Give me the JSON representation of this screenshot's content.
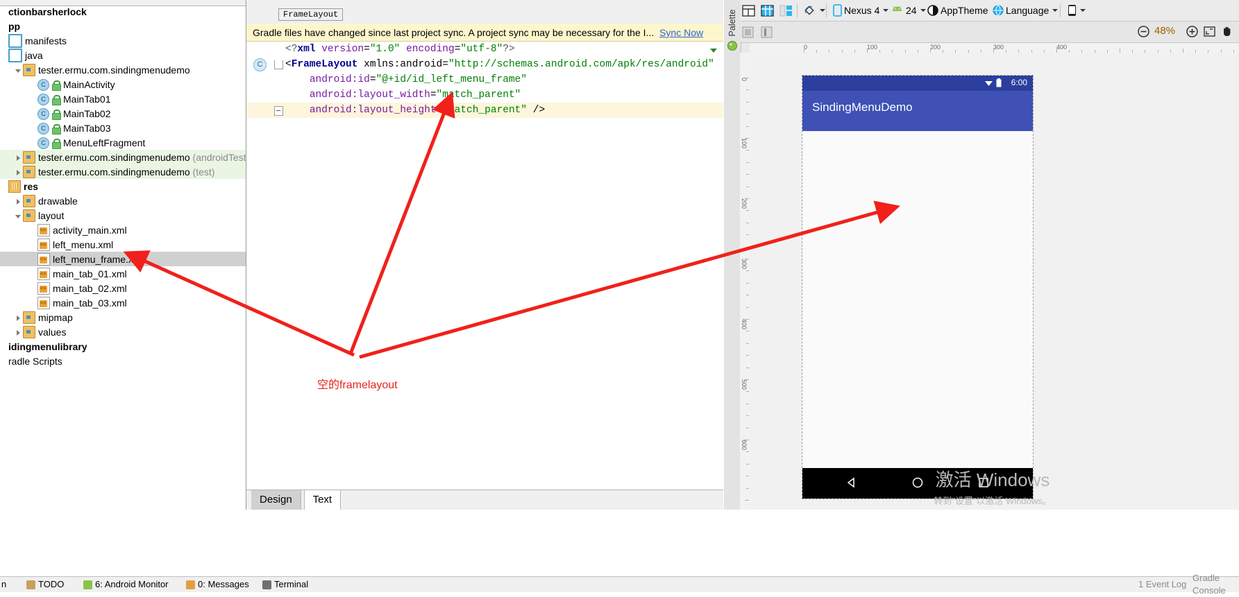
{
  "project": {
    "tree": [
      {
        "label": "ctionbarsherlock",
        "bold": true,
        "indent": 0,
        "icon": "none",
        "arrow": "none",
        "state": "normal"
      },
      {
        "label": "pp",
        "bold": true,
        "indent": 0,
        "icon": "none",
        "arrow": "none",
        "state": "normal"
      },
      {
        "label": "manifests",
        "bold": false,
        "indent": 0,
        "icon": "folder-blue-icon",
        "arrow": "none",
        "state": "normal"
      },
      {
        "label": "java",
        "bold": false,
        "indent": 0,
        "icon": "folder-blue-icon",
        "arrow": "none",
        "state": "normal"
      },
      {
        "label": "tester.ermu.com.sindingmenudemo",
        "bold": false,
        "indent": 1,
        "icon": "folder-icon",
        "arrow": "open",
        "state": "normal"
      },
      {
        "label": "MainActivity",
        "bold": false,
        "indent": 2,
        "icon": "class-icon",
        "arrow": "none",
        "state": "normal"
      },
      {
        "label": "MainTab01",
        "bold": false,
        "indent": 2,
        "icon": "class-icon",
        "arrow": "none",
        "state": "normal"
      },
      {
        "label": "MainTab02",
        "bold": false,
        "indent": 2,
        "icon": "class-icon",
        "arrow": "none",
        "state": "normal"
      },
      {
        "label": "MainTab03",
        "bold": false,
        "indent": 2,
        "icon": "class-icon",
        "arrow": "none",
        "state": "normal"
      },
      {
        "label": "MenuLeftFragment",
        "bold": false,
        "indent": 2,
        "icon": "class-icon",
        "arrow": "none",
        "state": "normal"
      },
      {
        "label": "tester.ermu.com.sindingmenudemo",
        "suffix": "(androidTest)",
        "bold": false,
        "indent": 1,
        "icon": "folder-icon",
        "arrow": "closed",
        "state": "green"
      },
      {
        "label": "tester.ermu.com.sindingmenudemo",
        "suffix": "(test)",
        "bold": false,
        "indent": 1,
        "icon": "folder-icon",
        "arrow": "closed",
        "state": "green"
      },
      {
        "label": "res",
        "bold": true,
        "indent": 0,
        "icon": "res-icon",
        "arrow": "none",
        "state": "normal"
      },
      {
        "label": "drawable",
        "bold": false,
        "indent": 1,
        "icon": "folder-icon",
        "arrow": "closed",
        "state": "normal"
      },
      {
        "label": "layout",
        "bold": false,
        "indent": 1,
        "icon": "folder-icon",
        "arrow": "open",
        "state": "normal"
      },
      {
        "label": "activity_main.xml",
        "bold": false,
        "indent": 2,
        "icon": "xml-file-icon",
        "arrow": "none",
        "state": "normal"
      },
      {
        "label": "left_menu.xml",
        "bold": false,
        "indent": 2,
        "icon": "xml-file-icon",
        "arrow": "none",
        "state": "normal"
      },
      {
        "label": "left_menu_frame.xml",
        "bold": false,
        "indent": 2,
        "icon": "xml-file-icon",
        "arrow": "none",
        "state": "selected"
      },
      {
        "label": "main_tab_01.xml",
        "bold": false,
        "indent": 2,
        "icon": "xml-file-icon",
        "arrow": "none",
        "state": "normal"
      },
      {
        "label": "main_tab_02.xml",
        "bold": false,
        "indent": 2,
        "icon": "xml-file-icon",
        "arrow": "none",
        "state": "normal"
      },
      {
        "label": "main_tab_03.xml",
        "bold": false,
        "indent": 2,
        "icon": "xml-file-icon",
        "arrow": "none",
        "state": "normal"
      },
      {
        "label": "mipmap",
        "bold": false,
        "indent": 1,
        "icon": "folder-icon",
        "arrow": "closed",
        "state": "normal"
      },
      {
        "label": "values",
        "bold": false,
        "indent": 1,
        "icon": "folder-icon",
        "arrow": "closed",
        "state": "normal"
      },
      {
        "label": "idingmenulibrary",
        "bold": true,
        "indent": 0,
        "icon": "none",
        "arrow": "none",
        "state": "normal"
      },
      {
        "label": "radle Scripts",
        "bold": false,
        "indent": 0,
        "icon": "none",
        "arrow": "none",
        "state": "normal"
      }
    ]
  },
  "editor": {
    "breadcrumb": "FrameLayout",
    "sync_banner": {
      "message": "Gradle files have changed since last project sync. A project sync may be necessary for the I...",
      "link": "Sync Now"
    },
    "class_marker": "C",
    "code_lines": [
      {
        "indent": 0,
        "tokens": [
          {
            "t": "<?",
            "c": "grey"
          },
          {
            "t": "xml",
            "c": "kw"
          },
          {
            "t": " ",
            "c": "pl"
          },
          {
            "t": "version",
            "c": "attr"
          },
          {
            "t": "=",
            "c": "pl"
          },
          {
            "t": "\"1.0\"",
            "c": "str"
          },
          {
            "t": " ",
            "c": "pl"
          },
          {
            "t": "encoding",
            "c": "attr"
          },
          {
            "t": "=",
            "c": "pl"
          },
          {
            "t": "\"utf-8\"",
            "c": "str"
          },
          {
            "t": "?>",
            "c": "grey"
          }
        ]
      },
      {
        "indent": 0,
        "tokens": [
          {
            "t": "<",
            "c": "pl"
          },
          {
            "t": "FrameLayout",
            "c": "tag"
          },
          {
            "t": " ",
            "c": "pl"
          },
          {
            "t": "xmlns:android",
            "c": "pl"
          },
          {
            "t": "=",
            "c": "pl"
          },
          {
            "t": "\"http://schemas.android.com/apk/res/android\"",
            "c": "str"
          }
        ]
      },
      {
        "indent": 1,
        "tokens": [
          {
            "t": "android:id",
            "c": "attr"
          },
          {
            "t": "=",
            "c": "pl"
          },
          {
            "t": "\"@+id/id_left_menu_frame\"",
            "c": "str"
          }
        ]
      },
      {
        "indent": 1,
        "tokens": [
          {
            "t": "android:layout_width",
            "c": "attr"
          },
          {
            "t": "=",
            "c": "pl"
          },
          {
            "t": "\"match_parent\"",
            "c": "str"
          }
        ]
      },
      {
        "indent": 1,
        "tokens": [
          {
            "t": "android:layout_height",
            "c": "attr"
          },
          {
            "t": "=",
            "c": "pl"
          },
          {
            "t": "\"match_parent\"",
            "c": "str"
          },
          {
            "t": " />",
            "c": "pl"
          }
        ]
      }
    ],
    "bottom_tabs": [
      {
        "label": "Design",
        "active": false
      },
      {
        "label": "Text",
        "active": true
      }
    ]
  },
  "preview": {
    "palette_label": "Palette",
    "toolbar": {
      "device_label": "Nexus 4",
      "api_label": "24",
      "theme_label": "AppTheme",
      "language_label": "Language",
      "zoom_level": "48%"
    },
    "ruler_ticks_h": [
      "0",
      "100",
      "200",
      "300",
      "400"
    ],
    "ruler_ticks_v": [
      "0",
      "100",
      "200",
      "300",
      "400",
      "500",
      "600"
    ],
    "device": {
      "clock": "6:00",
      "app_title": "SindingMenuDemo"
    }
  },
  "watermark": {
    "line1": "激活 Windows",
    "line2": "转到\"设置\"以激活 Windows。"
  },
  "annotation": {
    "text": "空的framelayout",
    "color": "#e8231a"
  },
  "statusbar": {
    "items": [
      {
        "label": "n",
        "icon": "none"
      },
      {
        "label": "TODO",
        "icon": "todo-icon"
      },
      {
        "label": "6: Android Monitor",
        "icon": "android-icon",
        "underline_char": "6"
      },
      {
        "label": "0: Messages",
        "icon": "messages-icon",
        "underline_char": "0"
      },
      {
        "label": "Terminal",
        "icon": "terminal-icon"
      }
    ],
    "right_items": [
      {
        "label": "1 Event Log",
        "icon": "event-log-icon"
      },
      {
        "label": "Gradle Console",
        "icon": "gradle-console-icon"
      }
    ]
  }
}
